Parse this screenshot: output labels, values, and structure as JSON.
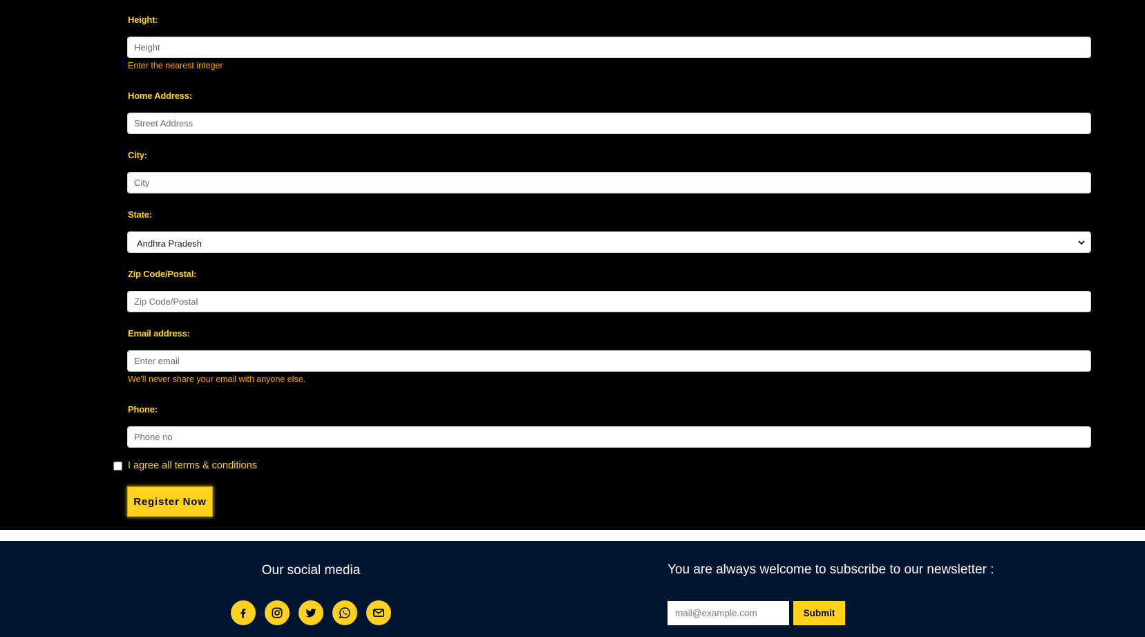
{
  "form": {
    "height": {
      "label": "Height:",
      "placeholder": "Height",
      "help": "Enter the nearest integer"
    },
    "address": {
      "label": "Home Address:",
      "placeholder": "Street Address"
    },
    "city": {
      "label": "City:",
      "placeholder": "City"
    },
    "state": {
      "label": "State:",
      "selected": "Andhra Pradesh"
    },
    "zip": {
      "label": "Zip Code/Postal:",
      "placeholder": "Zip Code/Postal"
    },
    "email": {
      "label": "Email address:",
      "placeholder": "Enter email",
      "help": "We'll never share your email with anyone else."
    },
    "phone": {
      "label": "Phone:",
      "placeholder": "Phone no"
    },
    "terms_label": "I agree all terms & conditions",
    "register_label": "Register Now"
  },
  "footer": {
    "social_title": "Our social media",
    "social_icons": [
      "facebook-icon",
      "instagram-icon",
      "twitter-icon",
      "whatsapp-icon",
      "mail-icon"
    ],
    "newsletter_title": "You are always welcome to subscribe to our newsletter :",
    "newsletter_placeholder": "mail@example.com",
    "newsletter_submit": "Submit"
  },
  "colors": {
    "accent": "#ffd21f",
    "help_text": "#ffa500",
    "background": "#000000",
    "footer_bg": "#011430"
  }
}
